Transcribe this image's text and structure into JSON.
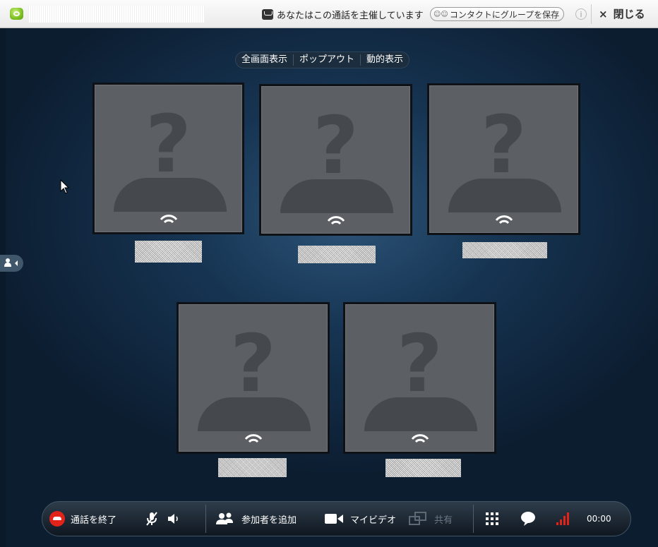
{
  "topbar": {
    "title_text": "",
    "hosting_message": "あなたはこの通話を主催しています",
    "save_group_label": "コンタクトにグループを保存",
    "info_label": "i",
    "close_icon": "×",
    "close_label": "閉じる"
  },
  "view_menu": {
    "items": [
      "全画面表示",
      "ポップアウト",
      "動的表示"
    ]
  },
  "participants": [
    {
      "name": "",
      "icon": "unknown-avatar",
      "status": "connected"
    },
    {
      "name": "",
      "icon": "unknown-avatar",
      "status": "connected"
    },
    {
      "name": "",
      "icon": "unknown-avatar",
      "status": "connected"
    },
    {
      "name": "",
      "icon": "unknown-avatar",
      "status": "connected"
    },
    {
      "name": "",
      "icon": "unknown-avatar",
      "status": "connected"
    }
  ],
  "call_controls": {
    "end_call_label": "通話を終了",
    "add_participant_label": "参加者を追加",
    "my_video_label": "マイビデオ",
    "share_label": "共有",
    "call_timer": "00:00"
  },
  "colors": {
    "end_call": "#e2231a",
    "signal": "#e2231a",
    "background": "#163452",
    "tile": "#5c5f63"
  }
}
